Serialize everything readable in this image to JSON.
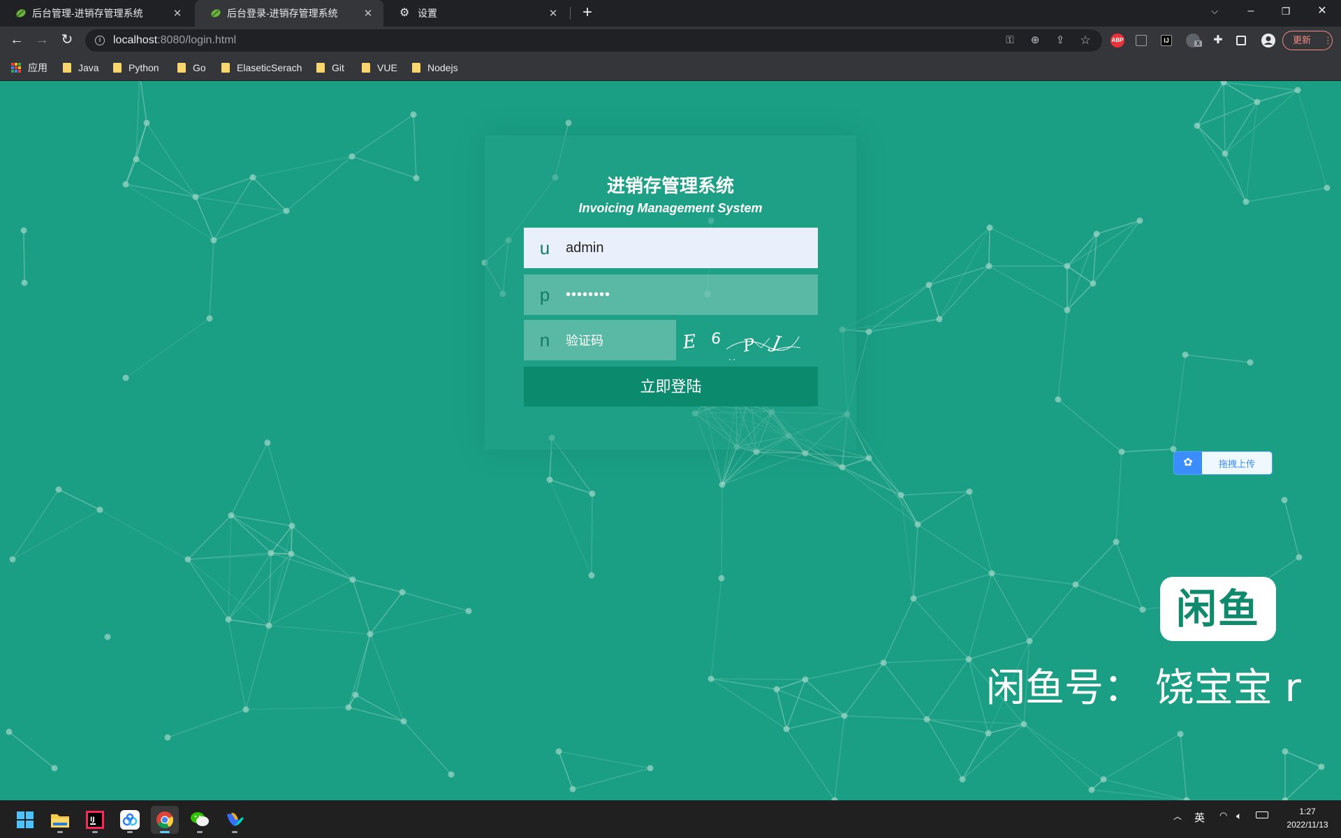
{
  "browser": {
    "tabs": [
      {
        "title": "后台管理-进销存管理系统",
        "active": false
      },
      {
        "title": "后台登录-进销存管理系统",
        "active": true
      },
      {
        "title": "设置",
        "active": false
      }
    ],
    "url_host": "localhost",
    "url_path": ":8080/login.html",
    "update_label": "更新",
    "ext_abp": "ABP",
    "ext_x": "X",
    "bookmarks": [
      "应用",
      "Java",
      "Python",
      "Go",
      "ElaseticSerach",
      "Git",
      "VUE",
      "Nodejs"
    ]
  },
  "login": {
    "title": "进销存管理系统",
    "subtitle": "Invoicing Management System",
    "username_prefix": "u",
    "username_value": "admin",
    "password_prefix": "p",
    "password_value": "••••••••",
    "captcha_prefix": "n",
    "captcha_placeholder": "验证码",
    "captcha_image_text": "E6PJ",
    "submit_label": "立即登陆"
  },
  "overlay": {
    "upload_label": "拖拽上传",
    "xianyu_logo_text": "闲鱼",
    "xianyu_id": "闲鱼号： 饶宝宝 r"
  },
  "taskbar": {
    "apps": [
      "start-icon",
      "file-explorer-icon",
      "intellij-idea-icon",
      "baidu-netdisk-icon",
      "chrome-icon",
      "wechat-icon",
      "feishu-icon"
    ],
    "ime": "英",
    "time": "1:27",
    "date": "2022/11/13"
  },
  "colors": {
    "page_background": "#1a9f85",
    "login_button": "#0c8a6e",
    "username_input_bg": "#e9f0fb"
  }
}
